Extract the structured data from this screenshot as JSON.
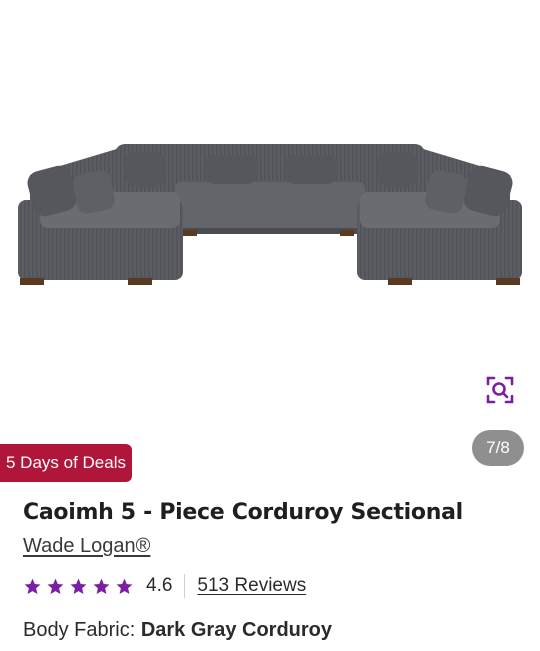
{
  "gallery": {
    "pager": "7/8",
    "zoom_icon": "zoom-search-icon",
    "image_subject": "Caoimh 5 - Piece Corduroy Sectional"
  },
  "promo": {
    "badge": "5 Days of Deals"
  },
  "product": {
    "title": "Caoimh 5 - Piece Corduroy Sectional",
    "brand": "Wade Logan®",
    "rating": "4.6",
    "rating_out_of_5": 4.6,
    "reviews": "513 Reviews",
    "option_label": "Body Fabric:",
    "option_value": "Dark Gray Corduroy"
  },
  "colors": {
    "accent": "#7b1fa2",
    "badge": "#b0153a",
    "pager_bg": "#8f8f8f",
    "sofa": "#5b5d63"
  }
}
